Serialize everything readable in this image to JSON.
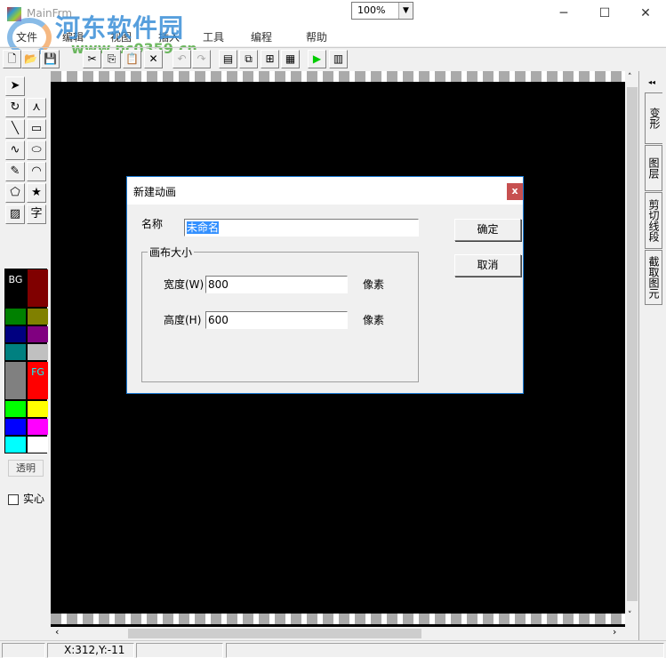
{
  "window": {
    "title": "MainFrm",
    "minimize": "─",
    "maximize": "☐",
    "close": "✕"
  },
  "watermark": {
    "text": "河东软件园",
    "url": "www.pc0359.cn"
  },
  "menu": [
    "文件",
    "编辑",
    "视图",
    "插入",
    "工具",
    "编程",
    "帮助"
  ],
  "toolbar": {
    "icons": [
      "new-icon",
      "open-icon",
      "save-icon",
      "cut-icon",
      "copy-icon",
      "paste-icon",
      "delete-icon",
      "undo-icon",
      "redo-icon",
      "properties-icon",
      "group-icon",
      "ungroup-icon",
      "tile-icon",
      "play-icon",
      "timeline-icon"
    ],
    "glyphs": [
      "🗋",
      "📂",
      "💾",
      "✂",
      "⎘",
      "📋",
      "✕",
      "↶",
      "↷",
      "▤",
      "⧉",
      "⊞",
      "▦",
      "▶",
      "▥"
    ],
    "zoom": "100%"
  },
  "tools": {
    "glyphs": [
      "➤",
      "",
      "↻",
      "⋏",
      "╲",
      "▭",
      "∿",
      "⬭",
      "✎",
      "◠",
      "⬠",
      "★",
      "▨",
      "字"
    ],
    "names": [
      "select",
      "",
      "rotate",
      "bezier",
      "line",
      "rectangle",
      "polyline",
      "ellipse",
      "pen",
      "arc",
      "polygon",
      "star",
      "image",
      "text"
    ]
  },
  "palette": [
    {
      "label": "BG",
      "color": "#000000"
    },
    {
      "label": "",
      "color": "#800000"
    },
    {
      "label": "",
      "color": "#008000"
    },
    {
      "label": "",
      "color": "#808000"
    },
    {
      "label": "",
      "color": "#000080"
    },
    {
      "label": "",
      "color": "#800080"
    },
    {
      "label": "",
      "color": "#008080"
    },
    {
      "label": "",
      "color": "#c0c0c0"
    },
    {
      "label": "",
      "color": "#808080"
    },
    {
      "label": "FG",
      "color": "#ff0000"
    },
    {
      "label": "",
      "color": "#00ff00"
    },
    {
      "label": "",
      "color": "#ffff00"
    },
    {
      "label": "",
      "color": "#0000ff"
    },
    {
      "label": "",
      "color": "#ff00ff"
    },
    {
      "label": "",
      "color": "#00ffff"
    },
    {
      "label": "",
      "color": "#ffffff"
    }
  ],
  "transparent_label": "透明",
  "solid_label": "实心",
  "right_tabs": {
    "collapse": "◂◂",
    "items": [
      "变形",
      "图层",
      "剪切线段",
      "截取图元"
    ]
  },
  "status": {
    "coords": "X:312,Y:-11"
  },
  "dialog": {
    "title": "新建动画",
    "close": "x",
    "name_label": "名称",
    "name_value": "未命名",
    "group_title": "画布大小",
    "width_label": "宽度(W)",
    "width_value": "800",
    "height_label": "高度(H)",
    "height_value": "600",
    "unit": "像素",
    "ok": "确定",
    "cancel": "取消"
  }
}
